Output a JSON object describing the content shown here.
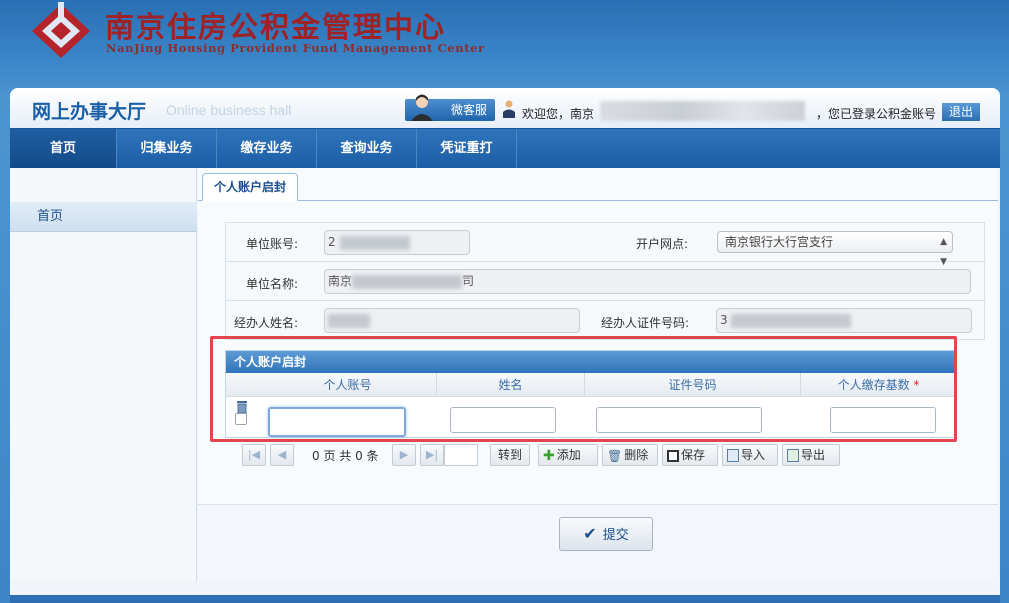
{
  "header": {
    "title": "南京住房公积金管理中心",
    "subtitle": "NanJing Housing Provident Fund Management Center"
  },
  "hall": {
    "title": "网上办事大厅",
    "subtitle": "Online business hall",
    "service_label": "微客服",
    "welcome_prefix": "欢迎您，南京",
    "login_tip": "，您已登录公积金账号",
    "logout_label": "退出"
  },
  "nav": {
    "items": [
      {
        "label": "首页"
      },
      {
        "label": "归集业务"
      },
      {
        "label": "缴存业务"
      },
      {
        "label": "查询业务"
      },
      {
        "label": "凭证重打"
      }
    ]
  },
  "sidebar": {
    "items": [
      {
        "label": "首页"
      }
    ]
  },
  "tab": {
    "label": "个人账户启封"
  },
  "form": {
    "unit_account_label": "单位账号:",
    "unit_account_value": "2",
    "branch_label": "开户网点:",
    "branch_value": "南京银行大行宫支行",
    "unit_name_label": "单位名称:",
    "unit_name_prefix": "南京",
    "unit_name_suffix": "司",
    "handler_name_label": "经办人姓名:",
    "handler_id_label": "经办人证件号码:",
    "handler_id_value": "3"
  },
  "grid": {
    "title": "个人账户启封",
    "columns": [
      {
        "label": "个人账号"
      },
      {
        "label": "姓名"
      },
      {
        "label": "证件号码"
      },
      {
        "label": "个人缴存基数",
        "required_mark": "*"
      }
    ]
  },
  "pager": {
    "page_info": "0 页 共 0 条",
    "goto_label": "转到",
    "add_label": "添加",
    "delete_label": "删除",
    "save_label": "保存",
    "import_label": "导入",
    "export_label": "导出"
  },
  "submit": {
    "label": "提交"
  },
  "colors": {
    "brand_red": "#9d2326",
    "nav_blue": "#1c5ea5",
    "highlight_red": "#e0464b"
  }
}
